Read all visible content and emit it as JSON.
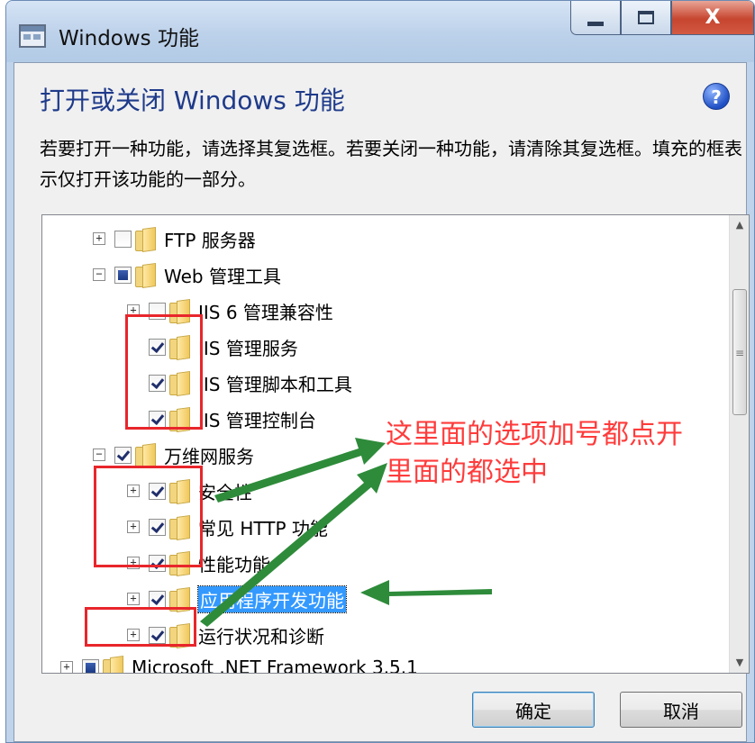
{
  "window": {
    "title": "Windows 功能",
    "minimize_glyph": "—",
    "maximize_glyph": "□",
    "close_glyph": "X"
  },
  "dialog": {
    "heading": "打开或关闭 Windows 功能",
    "help_glyph": "?",
    "description": "若要打开一种功能，请选择其复选框。若要关闭一种功能，请清除其复选框。填充的框表示仅打开该功能的一部分。"
  },
  "tree": {
    "items": [
      {
        "label": "FTP 服务器",
        "state": "unchecked",
        "expander": "+",
        "level": 1
      },
      {
        "label": "Web 管理工具",
        "state": "partial",
        "expander": "−",
        "level": 1
      },
      {
        "label": "IIS 6 管理兼容性",
        "state": "unchecked",
        "expander": "+",
        "level": 2
      },
      {
        "label": "IIS 管理服务",
        "state": "checked",
        "expander": "",
        "level": 2
      },
      {
        "label": "IIS 管理脚本和工具",
        "state": "checked",
        "expander": "",
        "level": 2
      },
      {
        "label": "IIS 管理控制台",
        "state": "checked",
        "expander": "",
        "level": 2
      },
      {
        "label": "万维网服务",
        "state": "checked",
        "expander": "−",
        "level": 1
      },
      {
        "label": "安全性",
        "state": "checked",
        "expander": "+",
        "level": 2
      },
      {
        "label": "常见 HTTP 功能",
        "state": "checked",
        "expander": "+",
        "level": 2
      },
      {
        "label": "性能功能",
        "state": "checked",
        "expander": "+",
        "level": 2
      },
      {
        "label": "应用程序开发功能",
        "state": "checked",
        "expander": "+",
        "level": 2,
        "selected": true
      },
      {
        "label": "运行状况和诊断",
        "state": "checked",
        "expander": "+",
        "level": 2
      },
      {
        "label": "Microsoft .NET Framework 3.5.1",
        "state": "partial",
        "expander": "+",
        "level": 0
      }
    ],
    "scroll_up": "▲",
    "scroll_down": "▼",
    "thumb_grip": "≡"
  },
  "buttons": {
    "ok": "确定",
    "cancel": "取消"
  },
  "annotation": {
    "line1": "这里面的选项加号都点开",
    "line2": "里面的都选中",
    "color": "#ff3b3b",
    "arrow_color": "#2e8b3a",
    "box_color": "#e8262b"
  }
}
